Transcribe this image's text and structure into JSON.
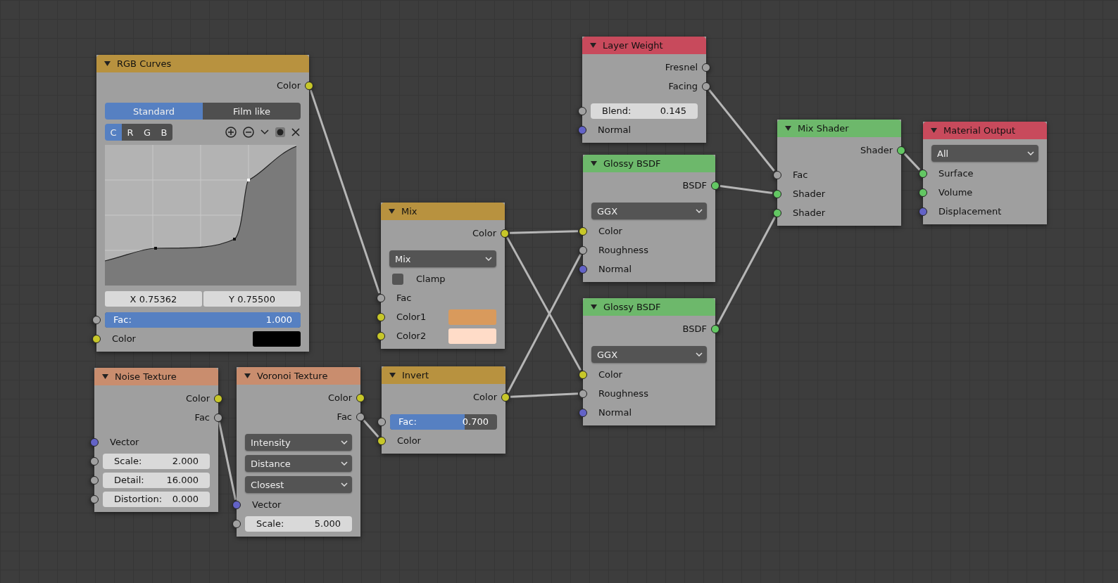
{
  "nodes": [
    {
      "title": "RGB Curves",
      "kind": "color",
      "rows": [
        {
          "kind": "out",
          "label": "Color",
          "socket": {
            "color": "#c7c729"
          }
        },
        {
          "kind": "tabs",
          "tabs": [
            {
              "label": "Standard",
              "selected": true
            },
            {
              "label": "Film like",
              "selected": false
            }
          ]
        },
        {
          "kind": "channels",
          "channels": [
            {
              "label": "C",
              "selected": true
            },
            {
              "label": "R",
              "selected": false
            },
            {
              "label": "G",
              "selected": false
            },
            {
              "label": "B",
              "selected": false
            }
          ]
        },
        {
          "kind": "curve"
        },
        {
          "kind": "coords",
          "x": "X 0.75362",
          "y": "Y 0.75500"
        },
        {
          "kind": "slider",
          "label": "Fac:",
          "value": "1.000",
          "level": 1,
          "socket": {
            "color": "#a1a1a1"
          }
        },
        {
          "kind": "swatch",
          "label": "Color",
          "color": "#000000",
          "socket": {
            "color": "#c7c729"
          }
        }
      ]
    },
    {
      "title": "Noise Texture",
      "kind": "texture",
      "rows": [
        {
          "kind": "out",
          "label": "Color",
          "socket": {
            "color": "#c7c729"
          }
        },
        {
          "kind": "out",
          "label": "Fac",
          "socket": {
            "color": "#a1a1a1"
          }
        },
        {
          "kind": "in",
          "label": "Vector",
          "socket": {
            "color": "#6363c7"
          }
        },
        {
          "kind": "field",
          "label": "Scale:",
          "value": "2.000",
          "socket": {
            "color": "#a1a1a1"
          }
        },
        {
          "kind": "field",
          "label": "Detail:",
          "value": "16.000",
          "socket": {
            "color": "#a1a1a1"
          }
        },
        {
          "kind": "field",
          "label": "Distortion:",
          "value": "0.000",
          "socket": {
            "color": "#a1a1a1"
          }
        }
      ]
    },
    {
      "title": "Voronoi Texture",
      "kind": "texture",
      "rows": [
        {
          "kind": "out",
          "label": "Color",
          "socket": {
            "color": "#c7c729"
          }
        },
        {
          "kind": "out",
          "label": "Fac",
          "socket": {
            "color": "#a1a1a1"
          }
        },
        {
          "kind": "dropdown",
          "value": "Intensity"
        },
        {
          "kind": "dropdown",
          "value": "Distance"
        },
        {
          "kind": "dropdown",
          "value": "Closest"
        },
        {
          "kind": "in",
          "label": "Vector",
          "socket": {
            "color": "#6363c7"
          }
        },
        {
          "kind": "field",
          "label": "Scale:",
          "value": "5.000",
          "socket": {
            "color": "#a1a1a1"
          }
        }
      ]
    },
    {
      "title": "Mix",
      "kind": "color",
      "rows": [
        {
          "kind": "out",
          "label": "Color",
          "socket": {
            "color": "#c7c729"
          }
        },
        {
          "kind": "dropdown",
          "value": "Mix"
        },
        {
          "kind": "checkbox",
          "label": "Clamp",
          "checked": false
        },
        {
          "kind": "in",
          "label": "Fac",
          "socket": {
            "color": "#a1a1a1"
          }
        },
        {
          "kind": "swatch",
          "label": "Color1",
          "color": "#d99a5c",
          "socket": {
            "color": "#c7c729"
          }
        },
        {
          "kind": "swatch",
          "label": "Color2",
          "color": "#ffdcc8",
          "socket": {
            "color": "#c7c729"
          }
        }
      ]
    },
    {
      "title": "Invert",
      "kind": "color",
      "rows": [
        {
          "kind": "out",
          "label": "Color",
          "socket": {
            "color": "#c7c729"
          }
        },
        {
          "kind": "slider",
          "label": "Fac:",
          "value": "0.700",
          "level": 0.7,
          "socket": {
            "color": "#a1a1a1"
          }
        },
        {
          "kind": "in",
          "label": "Color",
          "socket": {
            "color": "#c7c729"
          }
        }
      ]
    },
    {
      "title": "Layer Weight",
      "kind": "input",
      "rows": [
        {
          "kind": "out",
          "label": "Fresnel",
          "socket": {
            "color": "#a1a1a1"
          }
        },
        {
          "kind": "out",
          "label": "Facing",
          "socket": {
            "color": "#a1a1a1"
          }
        },
        {
          "kind": "field",
          "label": "Blend:",
          "value": "0.145",
          "socket": {
            "color": "#a1a1a1"
          }
        },
        {
          "kind": "in",
          "label": "Normal",
          "socket": {
            "color": "#6363c7"
          }
        }
      ]
    },
    {
      "title": "Glossy BSDF",
      "kind": "shader",
      "rows": [
        {
          "kind": "out",
          "label": "BSDF",
          "socket": {
            "color": "#63c763"
          }
        },
        {
          "kind": "dropdown",
          "value": "GGX"
        },
        {
          "kind": "in",
          "label": "Color",
          "socket": {
            "color": "#c7c729"
          }
        },
        {
          "kind": "in",
          "label": "Roughness",
          "socket": {
            "color": "#a1a1a1"
          }
        },
        {
          "kind": "in",
          "label": "Normal",
          "socket": {
            "color": "#6363c7"
          }
        }
      ]
    },
    {
      "title": "Glossy BSDF",
      "kind": "shader",
      "rows": [
        {
          "kind": "out",
          "label": "BSDF",
          "socket": {
            "color": "#63c763"
          }
        },
        {
          "kind": "dropdown",
          "value": "GGX"
        },
        {
          "kind": "in",
          "label": "Color",
          "socket": {
            "color": "#c7c729"
          }
        },
        {
          "kind": "in",
          "label": "Roughness",
          "socket": {
            "color": "#a1a1a1"
          }
        },
        {
          "kind": "in",
          "label": "Normal",
          "socket": {
            "color": "#6363c7"
          }
        }
      ]
    },
    {
      "title": "Mix Shader",
      "kind": "shader",
      "rows": [
        {
          "kind": "out",
          "label": "Shader",
          "socket": {
            "color": "#63c763"
          }
        },
        {
          "kind": "in",
          "label": "Fac",
          "socket": {
            "color": "#a1a1a1"
          }
        },
        {
          "kind": "in",
          "label": "Shader",
          "socket": {
            "color": "#63c763"
          }
        },
        {
          "kind": "in",
          "label": "Shader",
          "socket": {
            "color": "#63c763"
          }
        }
      ]
    },
    {
      "title": "Material Output",
      "kind": "output",
      "rows": [
        {
          "kind": "dropdown",
          "value": "All"
        },
        {
          "kind": "in",
          "label": "Surface",
          "socket": {
            "color": "#63c763"
          }
        },
        {
          "kind": "in",
          "label": "Volume",
          "socket": {
            "color": "#63c763"
          }
        },
        {
          "kind": "in",
          "label": "Displacement",
          "socket": {
            "color": "#6363c7"
          }
        }
      ]
    }
  ]
}
